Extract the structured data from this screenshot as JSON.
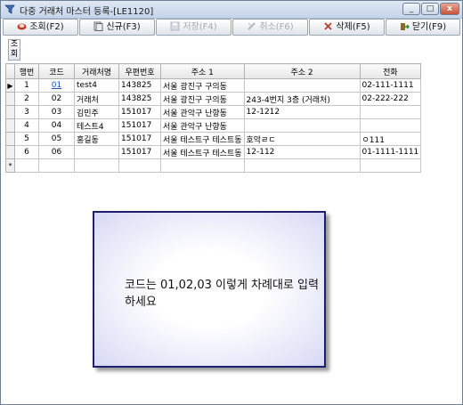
{
  "window": {
    "title": "다중 거래처 마스터 등록-[LE1120]",
    "controls": {
      "minimize": "_",
      "maximize": "□",
      "close": "x"
    }
  },
  "toolbar": {
    "buttons": [
      {
        "label": "조회(F2)",
        "icon": "search-icon",
        "enabled": true
      },
      {
        "label": "신규(F3)",
        "icon": "new-icon",
        "enabled": true
      },
      {
        "label": "저장(F4)",
        "icon": "save-icon",
        "enabled": false
      },
      {
        "label": "취소(F6)",
        "icon": "cancel-icon",
        "enabled": false
      },
      {
        "label": "삭제(F5)",
        "icon": "delete-icon",
        "enabled": true
      },
      {
        "label": "닫기(F9)",
        "icon": "close-door-icon",
        "enabled": true
      }
    ]
  },
  "side_button": {
    "label": "조\n회"
  },
  "grid": {
    "columns": [
      "행번",
      "코드",
      "거래처명",
      "우편번호",
      "주소 1",
      "주소 2",
      "전화"
    ],
    "rows": [
      {
        "indicator": "▶",
        "cells": [
          "1",
          "01",
          "test4",
          "143825",
          "서울 광진구 구의동",
          "",
          "02-111-1111"
        ]
      },
      {
        "indicator": "",
        "cells": [
          "2",
          "02",
          "거래처",
          "143825",
          "서울 광진구 구의동",
          "243-4번지 3층 (거래처)",
          "02-222-222"
        ]
      },
      {
        "indicator": "",
        "cells": [
          "3",
          "03",
          "김민주",
          "151017",
          "서울 관악구 난향동",
          "12-1212",
          ""
        ]
      },
      {
        "indicator": "",
        "cells": [
          "4",
          "04",
          "테스트4",
          "151017",
          "서울 관악구 난향동",
          "",
          ""
        ]
      },
      {
        "indicator": "",
        "cells": [
          "5",
          "05",
          "홍길동",
          "151017",
          "서울 테스트구 테스트동",
          "호악ㄹㄷ",
          "ㅇ111"
        ]
      },
      {
        "indicator": "",
        "cells": [
          "6",
          "06",
          "",
          "151017",
          "서울 테스트구 테스트동",
          "12-112",
          "01-1111-1111"
        ]
      },
      {
        "indicator": "*",
        "cells": [
          "",
          "",
          "",
          "",
          "",
          "",
          ""
        ]
      }
    ]
  },
  "note": {
    "text": "코드는 01,02,03 이렇게 차례대로 입력하세요"
  }
}
